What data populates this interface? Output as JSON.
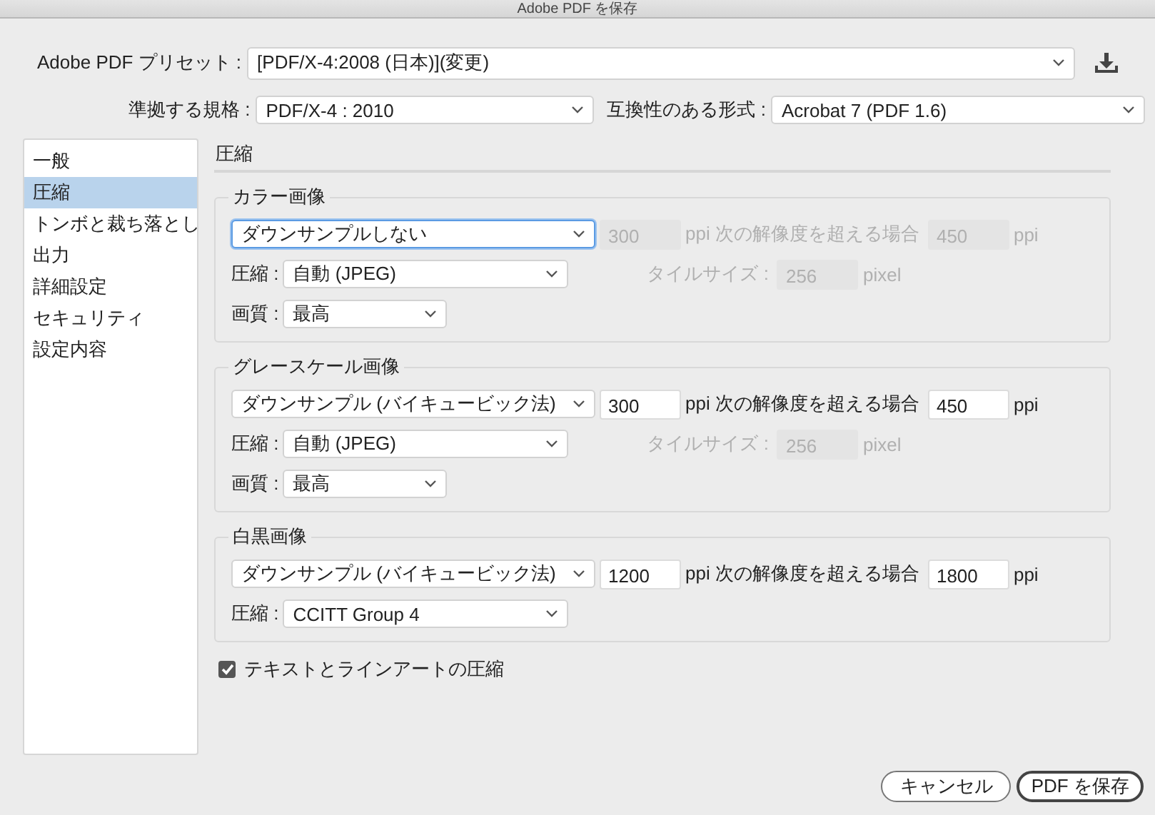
{
  "window": {
    "title": "Adobe PDF を保存"
  },
  "preset": {
    "label": "Adobe PDF プリセット :",
    "value": "[PDF/X-4:2008 (日本)](変更)"
  },
  "standard": {
    "label": "準拠する規格 :",
    "value": "PDF/X-4 : 2010"
  },
  "compatibility": {
    "label": "互換性のある形式 :",
    "value": "Acrobat 7 (PDF 1.6)"
  },
  "sidebar": {
    "items": [
      {
        "label": "一般",
        "selected": false
      },
      {
        "label": "圧縮",
        "selected": true
      },
      {
        "label": "トンボと裁ち落とし",
        "selected": false
      },
      {
        "label": "出力",
        "selected": false
      },
      {
        "label": "詳細設定",
        "selected": false
      },
      {
        "label": "セキュリティ",
        "selected": false
      },
      {
        "label": "設定内容",
        "selected": false
      }
    ]
  },
  "panel": {
    "title": "圧縮",
    "sections": [
      {
        "title": "カラー画像",
        "rows": [
          {
            "kind": "downsample",
            "method": "ダウンサンプルしない",
            "focused": true,
            "disabled": true,
            "resolution": "300",
            "middle_label": "ppi 次の解像度を超える場合",
            "threshold": "450",
            "unit": "ppi"
          },
          {
            "kind": "compression",
            "label": "圧縮 :",
            "value": "自動 (JPEG)",
            "tile": {
              "label": "タイルサイズ :",
              "value": "256",
              "unit": "pixel",
              "disabled": true
            }
          },
          {
            "kind": "quality",
            "label": "画質 :",
            "value": "最高"
          }
        ]
      },
      {
        "title": "グレースケール画像",
        "rows": [
          {
            "kind": "downsample",
            "method": "ダウンサンプル (バイキュービック法)",
            "focused": false,
            "disabled": false,
            "resolution": "300",
            "middle_label": "ppi 次の解像度を超える場合",
            "threshold": "450",
            "unit": "ppi"
          },
          {
            "kind": "compression",
            "label": "圧縮 :",
            "value": "自動 (JPEG)",
            "tile": {
              "label": "タイルサイズ :",
              "value": "256",
              "unit": "pixel",
              "disabled": true
            }
          },
          {
            "kind": "quality",
            "label": "画質 :",
            "value": "最高"
          }
        ]
      },
      {
        "title": "白黒画像",
        "rows": [
          {
            "kind": "downsample",
            "method": "ダウンサンプル (バイキュービック法)",
            "focused": false,
            "disabled": false,
            "resolution": "1200",
            "middle_label": "ppi 次の解像度を超える場合",
            "threshold": "1800",
            "unit": "ppi"
          },
          {
            "kind": "compression",
            "label": "圧縮 :",
            "value": "CCITT Group 4"
          }
        ]
      }
    ]
  },
  "checkbox": {
    "label": "テキストとラインアートの圧縮",
    "checked": true
  },
  "buttons": [
    {
      "label": "キャンセル",
      "default": false
    },
    {
      "label": "PDF を保存",
      "default": true
    }
  ]
}
